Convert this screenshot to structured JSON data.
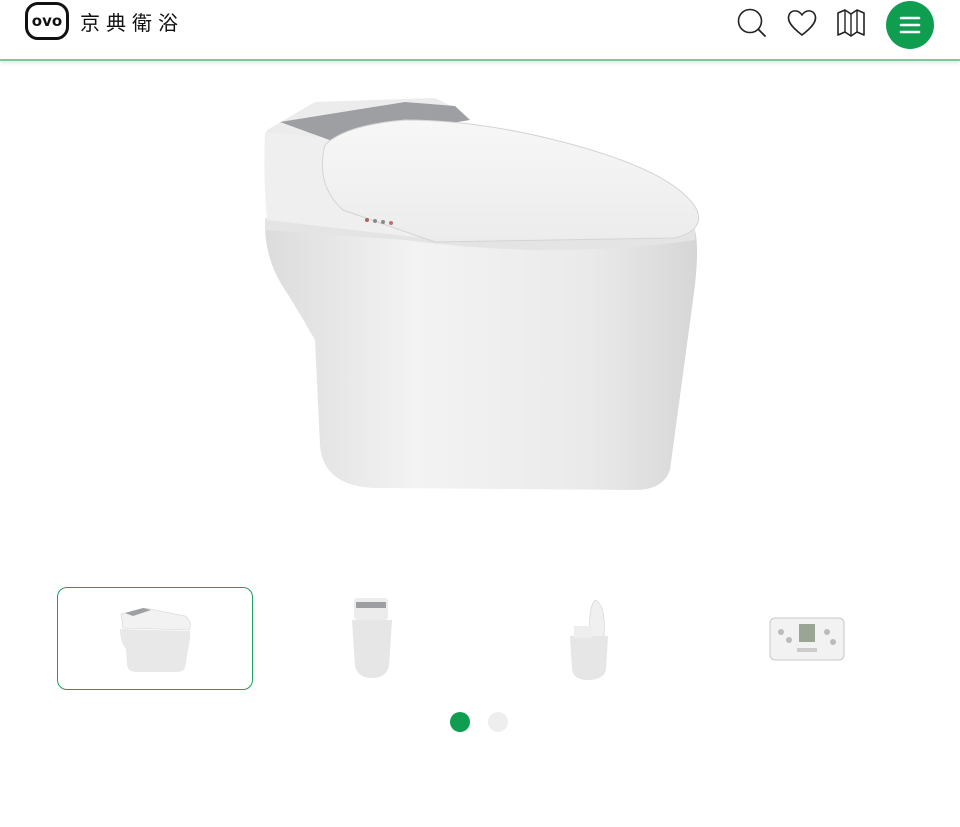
{
  "brand": {
    "logo_mark": "ovo",
    "name": "京典衛浴",
    "accent": "#0f9d50"
  },
  "header": {
    "icons": [
      "search-icon",
      "heart-icon",
      "catalog-book-icon",
      "menu-icon"
    ]
  },
  "gallery": {
    "main_image": "smart-toilet-front-angle",
    "thumbnails": [
      {
        "name": "thumbnail-toilet-angle",
        "active": true
      },
      {
        "name": "thumbnail-toilet-front",
        "active": false
      },
      {
        "name": "thumbnail-toilet-lid-open",
        "active": false
      },
      {
        "name": "thumbnail-remote-control",
        "active": false
      }
    ],
    "pagination": {
      "current": 1,
      "total": 2
    }
  }
}
